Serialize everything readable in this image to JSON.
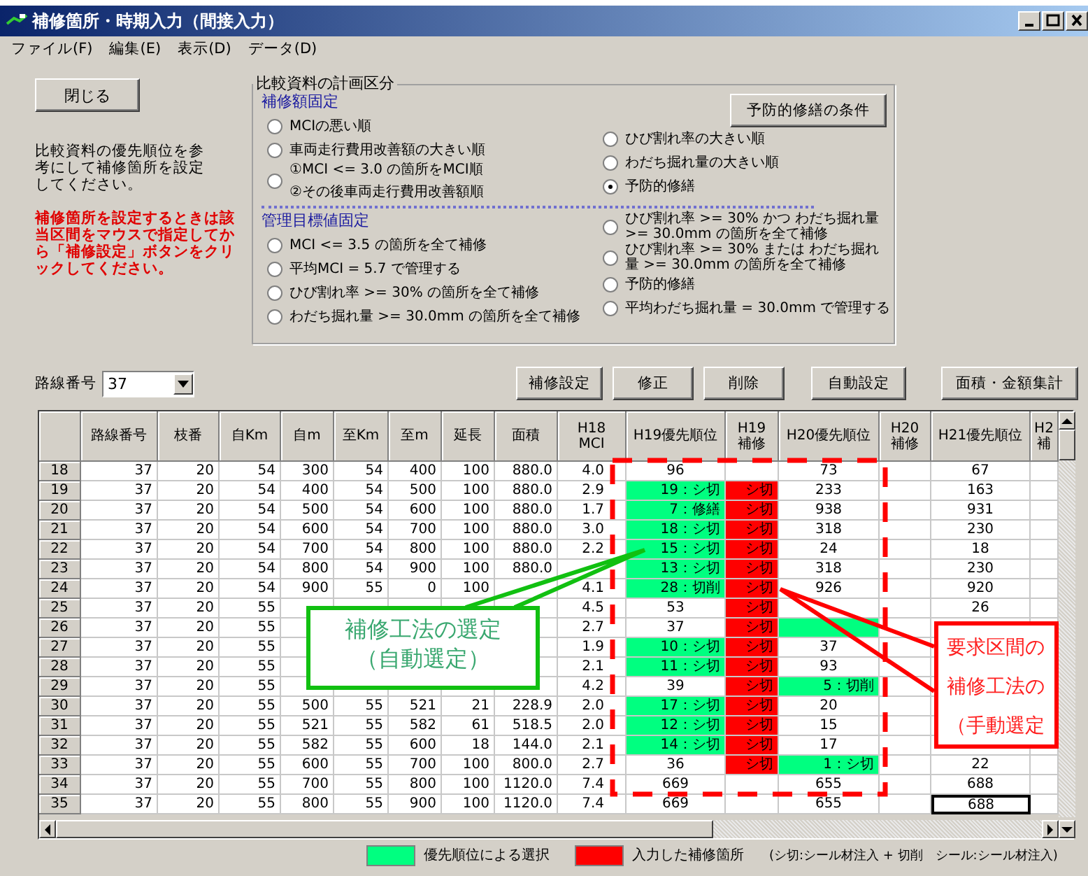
{
  "window": {
    "title": "補修箇所・時期入力（間接入力）"
  },
  "menu": [
    "ファイル(F)",
    "編集(E)",
    "表示(D)",
    "データ(D)"
  ],
  "close_button": "閉じる",
  "hint": "比較資料の優先順位を参考にして補修箇所を設定してください。",
  "warning": "補修箇所を設定するときは該当区間をマウスで指定してから「補修設定」ボタンをクリックしてください。",
  "plan_group": {
    "title": "比較資料の計画区分",
    "condition_button": "予防的修繕の条件",
    "sections": [
      {
        "title": "補修額固定",
        "left": [
          {
            "label": "MCIの悪い順",
            "selected": false
          },
          {
            "label": "車両走行費用改善額の大きい順",
            "selected": false
          },
          {
            "label": "①MCI <= 3.0 の箇所をMCI順",
            "sub": "②その後車両走行費用改善額順",
            "selected": false
          }
        ],
        "right": [
          {
            "label": "ひび割れ率の大きい順",
            "selected": false
          },
          {
            "label": "わだち掘れ量の大きい順",
            "selected": false
          },
          {
            "label": "予防的修繕",
            "selected": true
          }
        ]
      },
      {
        "title": "管理目標値固定",
        "left": [
          {
            "label": "MCI <= 3.5 の箇所を全て補修",
            "selected": false
          },
          {
            "label": "平均MCI = 5.7 で管理する",
            "selected": false
          },
          {
            "label": "ひび割れ率 >= 30% の箇所を全て補修",
            "selected": false
          },
          {
            "label": "わだち掘れ量 >= 30.0mm の箇所を全て補修",
            "selected": false
          }
        ],
        "right": [
          {
            "label": "ひび割れ率 >= 30% かつ わだち掘れ量 >= 30.0mm の箇所を全て補修",
            "selected": false
          },
          {
            "label": "ひび割れ率 >= 30% または わだち掘れ量 >= 30.0mm の箇所を全て補修",
            "selected": false
          },
          {
            "label": "予防的修繕",
            "selected": false
          },
          {
            "label": "平均わだち掘れ量 = 30.0mm で管理する",
            "selected": false
          }
        ]
      }
    ]
  },
  "route": {
    "label": "路線番号",
    "value": "37"
  },
  "actions": [
    "補修設定",
    "修正",
    "削除",
    "自動設定",
    "面積・金額集計"
  ],
  "table": {
    "columns": [
      "路線番号",
      "枝番",
      "自Km",
      "自m",
      "至Km",
      "至m",
      "延長",
      "面積",
      "H18\nMCI",
      "H19優先順位",
      "H19\n補修",
      "H20優先順位",
      "H20\n補修",
      "H21優先順位",
      "H2\n補"
    ],
    "rows": [
      {
        "header": "18",
        "cells": [
          "37",
          "20",
          "54",
          "300",
          "54",
          "400",
          "100",
          "880.0",
          "4.0",
          "96",
          null,
          "73",
          null,
          "67",
          null
        ]
      },
      {
        "header": "19",
        "cells": [
          "37",
          "20",
          "54",
          "400",
          "54",
          "500",
          "100",
          "880.0",
          "2.9",
          {
            "text": "19：シ切",
            "color": "#00ff80"
          },
          {
            "text": "シ切",
            "color": "#ff0000"
          },
          "233",
          null,
          "163",
          null
        ]
      },
      {
        "header": "20",
        "cells": [
          "37",
          "20",
          "54",
          "500",
          "54",
          "600",
          "100",
          "880.0",
          "1.7",
          {
            "text": "7：修繕",
            "color": "#00ff80"
          },
          {
            "text": "シ切",
            "color": "#ff0000"
          },
          "938",
          null,
          "931",
          null
        ]
      },
      {
        "header": "21",
        "cells": [
          "37",
          "20",
          "54",
          "600",
          "54",
          "700",
          "100",
          "880.0",
          "3.0",
          {
            "text": "18：シ切",
            "color": "#00ff80"
          },
          {
            "text": "シ切",
            "color": "#ff0000"
          },
          "318",
          null,
          "230",
          null
        ]
      },
      {
        "header": "22",
        "cells": [
          "37",
          "20",
          "54",
          "700",
          "54",
          "800",
          "100",
          "880.0",
          "2.2",
          {
            "text": "15：シ切",
            "color": "#00ff80"
          },
          {
            "text": "シ切",
            "color": "#ff0000"
          },
          "24",
          null,
          "18",
          null
        ]
      },
      {
        "header": "23",
        "cells": [
          "37",
          "20",
          "54",
          "800",
          "54",
          "900",
          "100",
          "880.0",
          null,
          {
            "text": "13：シ切",
            "color": "#00ff80"
          },
          {
            "text": "シ切",
            "color": "#ff0000"
          },
          "318",
          null,
          "230",
          null
        ]
      },
      {
        "header": "24",
        "cells": [
          "37",
          "20",
          "54",
          "900",
          "55",
          "0",
          "100",
          null,
          "4.1",
          {
            "text": "28：切削",
            "color": "#00ff80"
          },
          {
            "text": "シ切",
            "color": "#ff0000"
          },
          "926",
          null,
          "920",
          null
        ]
      },
      {
        "header": "25",
        "cells": [
          "37",
          "20",
          "55",
          null,
          null,
          null,
          null,
          null,
          "4.5",
          "53",
          {
            "text": "シ切",
            "color": "#ff0000"
          },
          null,
          null,
          "26",
          null
        ]
      },
      {
        "header": "26",
        "cells": [
          "37",
          "20",
          "55",
          null,
          null,
          null,
          null,
          null,
          "2.7",
          "37",
          {
            "text": "シ切",
            "color": "#ff0000"
          },
          {
            "color": "#00ff80"
          },
          null,
          null,
          null
        ]
      },
      {
        "header": "27",
        "cells": [
          "37",
          "20",
          "55",
          null,
          null,
          null,
          null,
          null,
          "1.9",
          {
            "text": "10：シ切",
            "color": "#00ff80"
          },
          {
            "text": "シ切",
            "color": "#ff0000"
          },
          "37",
          null,
          null,
          null
        ]
      },
      {
        "header": "28",
        "cells": [
          "37",
          "20",
          "55",
          null,
          null,
          null,
          null,
          null,
          "2.1",
          {
            "text": "11：シ切",
            "color": "#00ff80"
          },
          {
            "text": "シ切",
            "color": "#ff0000"
          },
          "93",
          null,
          null,
          null
        ]
      },
      {
        "header": "29",
        "cells": [
          "37",
          "20",
          "55",
          null,
          null,
          null,
          null,
          null,
          "4.2",
          "39",
          {
            "text": "シ切",
            "color": "#ff0000"
          },
          {
            "text": "5：切削",
            "color": "#00ff80"
          },
          null,
          null,
          null
        ]
      },
      {
        "header": "30",
        "cells": [
          "37",
          "20",
          "55",
          "500",
          "55",
          "521",
          "21",
          "228.9",
          "2.0",
          {
            "text": "17：シ切",
            "color": "#00ff80"
          },
          {
            "text": "シ切",
            "color": "#ff0000"
          },
          "20",
          null,
          null,
          null
        ]
      },
      {
        "header": "31",
        "cells": [
          "37",
          "20",
          "55",
          "521",
          "55",
          "582",
          "61",
          "518.5",
          "2.0",
          {
            "text": "12：シ切",
            "color": "#00ff80"
          },
          {
            "text": "シ切",
            "color": "#ff0000"
          },
          "15",
          null,
          null,
          null
        ]
      },
      {
        "header": "32",
        "cells": [
          "37",
          "20",
          "55",
          "582",
          "55",
          "600",
          "18",
          "144.0",
          "2.1",
          {
            "text": "14：シ切",
            "color": "#00ff80"
          },
          {
            "text": "シ切",
            "color": "#ff0000"
          },
          "17",
          null,
          null,
          null
        ]
      },
      {
        "header": "33",
        "cells": [
          "37",
          "20",
          "55",
          "600",
          "55",
          "700",
          "100",
          "800.0",
          "2.7",
          "36",
          {
            "text": "シ切",
            "color": "#ff0000"
          },
          {
            "text": "1：シ切",
            "color": "#00ff80"
          },
          null,
          "22",
          null
        ]
      },
      {
        "header": "34",
        "cells": [
          "37",
          "20",
          "55",
          "700",
          "55",
          "800",
          "100",
          "1120.0",
          "7.4",
          "669",
          null,
          "655",
          null,
          "688",
          null
        ]
      },
      {
        "header": "35",
        "cells": [
          "37",
          "20",
          "55",
          "800",
          "55",
          "900",
          "100",
          "1120.0",
          "7.4",
          "669",
          null,
          "655",
          null,
          {
            "text": "688",
            "selected": true
          },
          null
        ]
      }
    ]
  },
  "legend": [
    {
      "label": "優先順位による選択",
      "color": "#00ff80"
    },
    {
      "label": "入力した補修箇所",
      "color": "#ff0000"
    }
  ],
  "legend_note": "(シ切:シール材注入 + 切削　シール:シール材注入)",
  "callouts": [
    {
      "kind": "auto",
      "lines": [
        "補修工法の選定",
        "（自動選定）"
      ]
    },
    {
      "kind": "manual",
      "lines": [
        "要求区間の",
        "補修工法の",
        "（手動選定"
      ]
    }
  ]
}
